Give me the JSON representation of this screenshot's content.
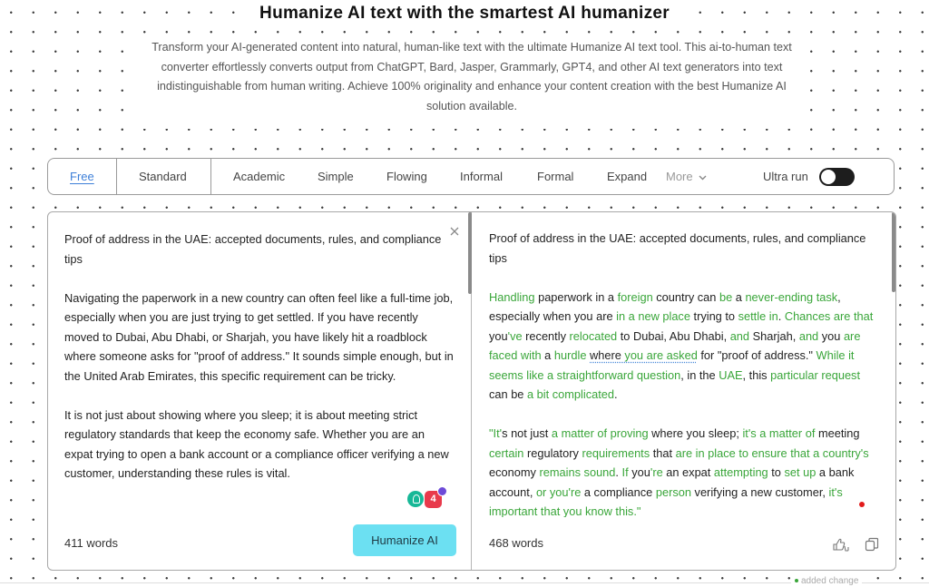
{
  "header": {
    "title": "Humanize AI text with the smartest AI humanizer",
    "subtitle": "Transform your AI-generated content into natural, human-like text with the ultimate Humanize AI text tool. This ai-to-human text converter effortlessly converts output from ChatGPT, Bard, Jasper, Grammarly, GPT4, and other AI text generators into text indistinguishable from human writing. Achieve 100% originality and enhance your content creation with the best Humanize AI solution available."
  },
  "modes": {
    "items": [
      "Free",
      "Standard",
      "Academic",
      "Simple",
      "Flowing",
      "Informal",
      "Formal",
      "Expand"
    ],
    "active": "Free",
    "more_label": "More",
    "ultra_label": "Ultra run",
    "ultra_on": true
  },
  "input": {
    "title": "Proof of address in the UAE: accepted documents, rules, and compliance tips",
    "paragraph1": "Navigating the paperwork in a new country can often feel like a full-time job, especially when you are just trying to get settled. If you have recently moved to Dubai, Abu Dhabi, or Sharjah, you have likely hit a roadblock where someone asks for \"proof of address.\" It sounds simple enough, but in the United Arab Emirates, this specific requirement can be tricky.",
    "paragraph2": "It is not just about showing where you sleep; it is about meeting strict regulatory standards that keep the economy safe. Whether you are an expat trying to open a bank account or a compliance officer verifying a new customer, understanding these rules is vital.",
    "word_count": "411 words",
    "humanize_label": "Humanize AI",
    "extension_badge": "4"
  },
  "output": {
    "title": "Proof of address in the UAE: accepted documents, rules, and compliance tips",
    "paragraph1": [
      {
        "t": "Handling",
        "c": 1
      },
      {
        "t": " paperwork in a ",
        "c": 0
      },
      {
        "t": "foreign",
        "c": 1
      },
      {
        "t": " country can ",
        "c": 0
      },
      {
        "t": "be",
        "c": 1
      },
      {
        "t": " a ",
        "c": 0
      },
      {
        "t": "never-ending task",
        "c": 1
      },
      {
        "t": ", especially when you are ",
        "c": 0
      },
      {
        "t": "in a new place",
        "c": 1
      },
      {
        "t": " trying to ",
        "c": 0
      },
      {
        "t": "settle in",
        "c": 1
      },
      {
        "t": ". ",
        "c": 0
      },
      {
        "t": "Chances are that",
        "c": 1
      },
      {
        "t": " you",
        "c": 0
      },
      {
        "t": "'ve",
        "c": 1
      },
      {
        "t": " recently ",
        "c": 0
      },
      {
        "t": "relocated",
        "c": 1
      },
      {
        "t": " to Dubai, Abu Dhabi, ",
        "c": 0
      },
      {
        "t": "and",
        "c": 1
      },
      {
        "t": " Sharjah, ",
        "c": 0
      },
      {
        "t": "and",
        "c": 1
      },
      {
        "t": " you ",
        "c": 0
      },
      {
        "t": "are faced with",
        "c": 1
      },
      {
        "t": " a ",
        "c": 0
      },
      {
        "t": "hurdle",
        "c": 1
      },
      {
        "t": " ",
        "c": 0
      },
      {
        "t": "where ",
        "c": 2
      },
      {
        "t": "you are asked",
        "c": 3
      },
      {
        "t": " for \"proof of address.\" ",
        "c": 0
      },
      {
        "t": "While it seems like a straightforward question",
        "c": 1
      },
      {
        "t": ", in the ",
        "c": 0
      },
      {
        "t": "UAE",
        "c": 1
      },
      {
        "t": ", this ",
        "c": 0
      },
      {
        "t": "particular request",
        "c": 1
      },
      {
        "t": " can be ",
        "c": 0
      },
      {
        "t": "a bit complicated",
        "c": 1
      },
      {
        "t": ".",
        "c": 0
      }
    ],
    "paragraph2": [
      {
        "t": "\"It'",
        "c": 1
      },
      {
        "t": "s not just ",
        "c": 0
      },
      {
        "t": "a matter of proving",
        "c": 1
      },
      {
        "t": " where you sleep; ",
        "c": 0
      },
      {
        "t": "it's a matter of",
        "c": 1
      },
      {
        "t": " meeting ",
        "c": 0
      },
      {
        "t": "certain",
        "c": 1
      },
      {
        "t": " regulatory ",
        "c": 0
      },
      {
        "t": "requirements",
        "c": 1
      },
      {
        "t": " that ",
        "c": 0
      },
      {
        "t": "are in place to ensure that a country's",
        "c": 1
      },
      {
        "t": " economy ",
        "c": 0
      },
      {
        "t": "remains sound",
        "c": 1
      },
      {
        "t": ". ",
        "c": 0
      },
      {
        "t": "If",
        "c": 1
      },
      {
        "t": " you",
        "c": 0
      },
      {
        "t": "'re",
        "c": 1
      },
      {
        "t": " an expat ",
        "c": 0
      },
      {
        "t": "attempting",
        "c": 1
      },
      {
        "t": " to ",
        "c": 0
      },
      {
        "t": "set up",
        "c": 1
      },
      {
        "t": " a bank account, ",
        "c": 0
      },
      {
        "t": "or you're",
        "c": 1
      },
      {
        "t": " a compliance ",
        "c": 0
      },
      {
        "t": "person",
        "c": 1
      },
      {
        "t": " verifying a new customer, ",
        "c": 0
      },
      {
        "t": "it's important that you know this.\"",
        "c": 1
      }
    ],
    "word_count": "468 words"
  },
  "legend": {
    "label": "added change"
  },
  "colors": {
    "changed": "#3aa63a",
    "humanize_button": "#6ce0f2",
    "active_tab": "#3d7fd8"
  }
}
